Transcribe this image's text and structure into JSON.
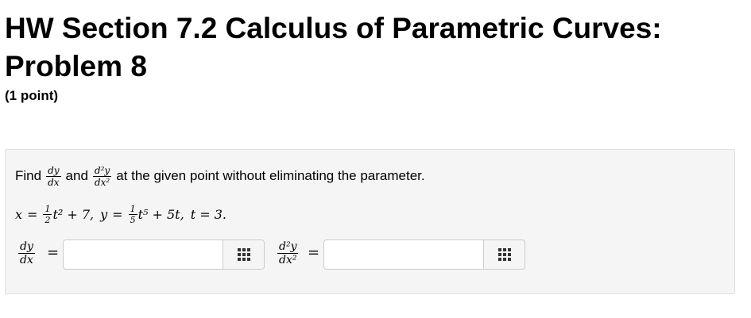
{
  "header": {
    "title": "HW Section 7.2 Calculus of Parametric Curves: Problem 8",
    "points": "(1 point)"
  },
  "problem": {
    "find_word": "Find",
    "and_word": "and",
    "instruction_tail": "at the given point without eliminating the parameter.",
    "dy": "dy",
    "dx": "dx",
    "d2y": "d²y",
    "dx2": "dx²",
    "equation": {
      "x_lhs": "x",
      "eq": "=",
      "x_coef_num": "1",
      "x_coef_den": "2",
      "x_rest": "t² + 7,",
      "y_lhs": "y",
      "y_coef_num": "1",
      "y_coef_den": "5",
      "y_rest": "t⁵ + 5t,",
      "t_part": "t = 3."
    }
  },
  "answers": [
    {
      "num": "dy",
      "den": "dx",
      "value": "",
      "keypad_icon": "grid-icon"
    },
    {
      "num": "d²y",
      "den": "dx²",
      "value": "",
      "keypad_icon": "grid-icon"
    }
  ],
  "equals_sign": "="
}
